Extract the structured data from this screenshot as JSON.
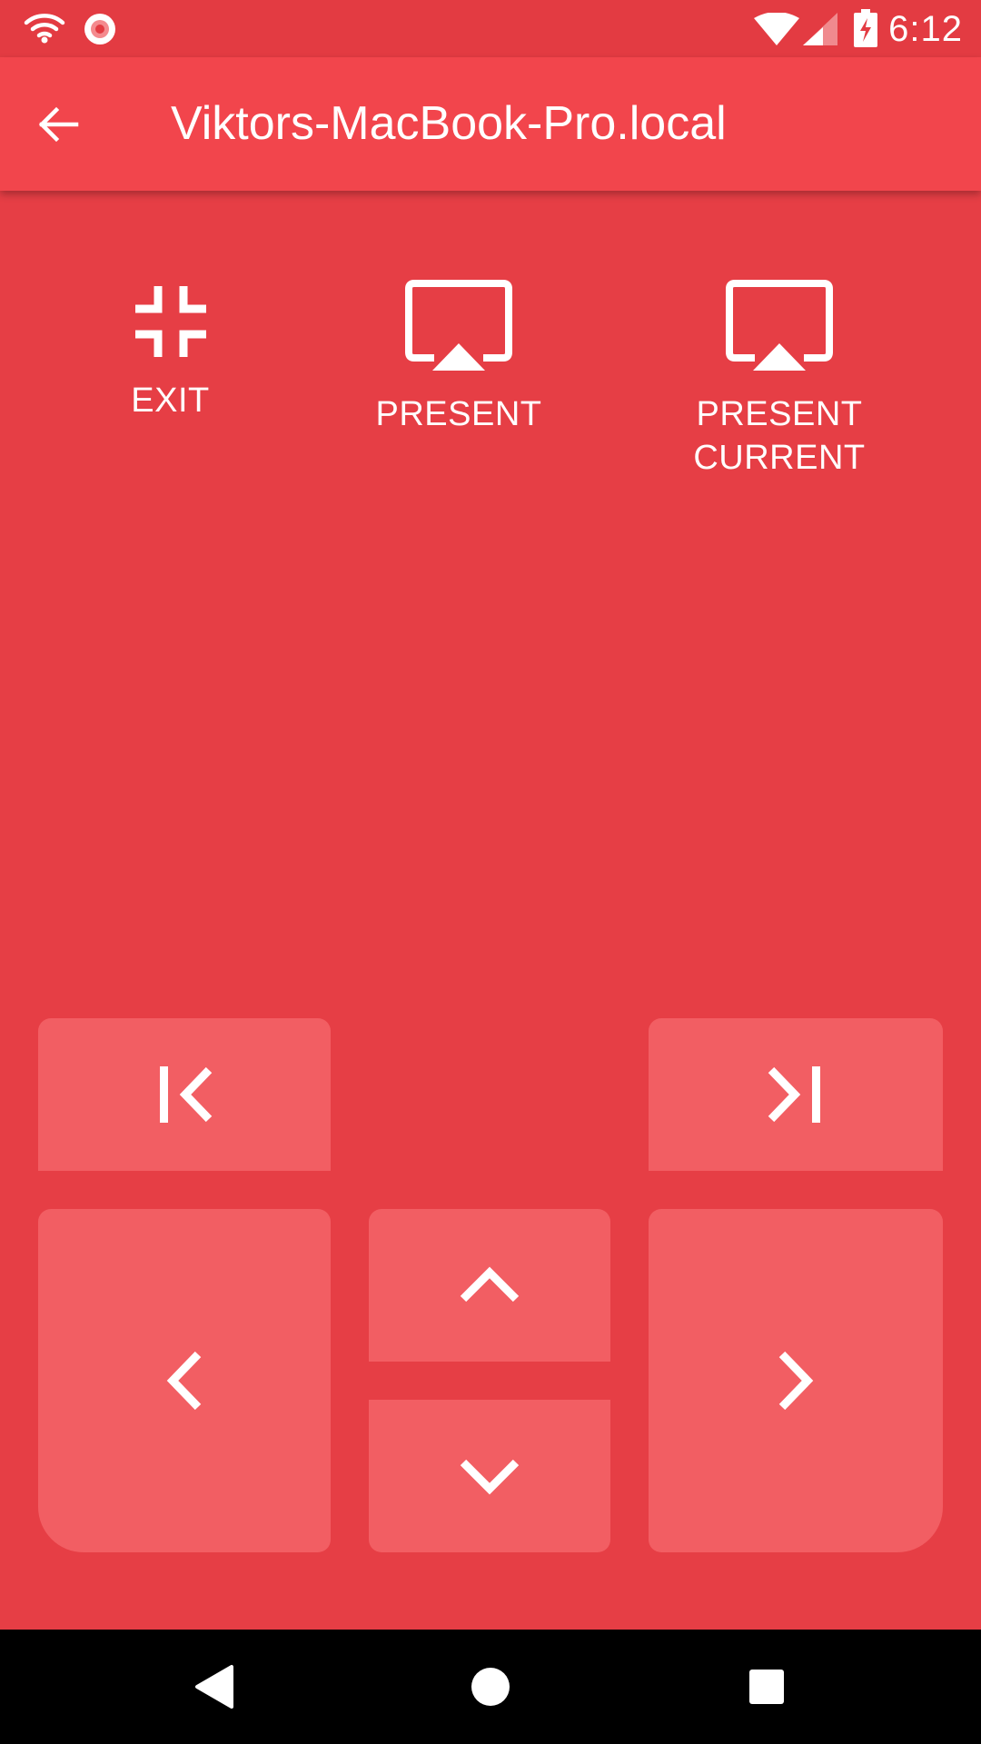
{
  "status_bar": {
    "time": "6:12",
    "icons": [
      "wifi-icon",
      "record-icon",
      "signal-wifi-icon",
      "cellular-signal-icon",
      "battery-charging-icon"
    ]
  },
  "app_bar": {
    "title": "Viktors-MacBook-Pro.local",
    "back_icon": "arrow-back-icon"
  },
  "actions": [
    {
      "label": "EXIT",
      "icon": "fullscreen-exit-icon"
    },
    {
      "label": "PRESENT",
      "icon": "airplay-icon"
    },
    {
      "label": "PRESENT\nCURRENT",
      "icon": "airplay-icon"
    }
  ],
  "controls": {
    "first": "first-slide-icon",
    "last": "last-slide-icon",
    "previous": "chevron-left-icon",
    "up": "chevron-up-icon",
    "down": "chevron-down-icon",
    "next": "chevron-right-icon"
  },
  "nav_bar": {
    "icons": [
      "back-triangle-icon",
      "home-circle-icon",
      "recents-square-icon"
    ]
  },
  "colors": {
    "background": "#e63e45",
    "app_bar": "#f2454c",
    "pad": "#f25e63",
    "foreground": "#ffffff"
  }
}
